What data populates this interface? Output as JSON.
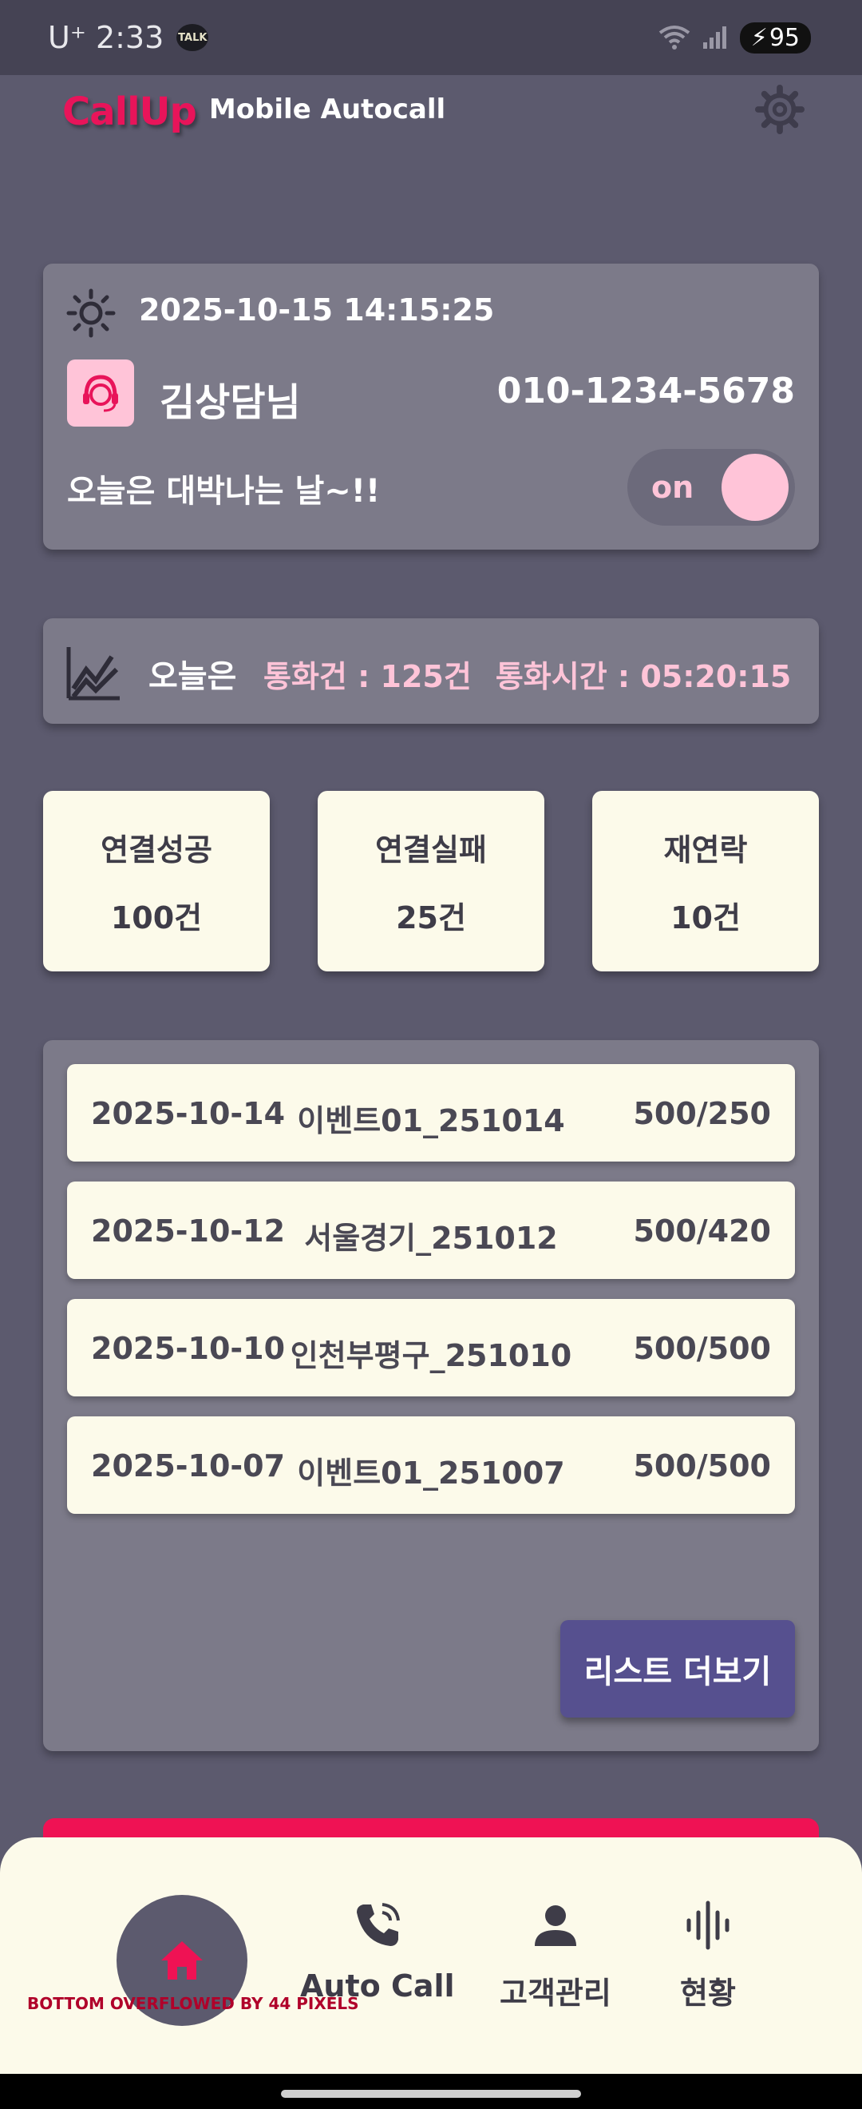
{
  "status_bar": {
    "carrier": "U⁺ 2:33",
    "talk_badge": "TALK",
    "battery": "95",
    "icons": [
      "wifi-icon",
      "signal-icon",
      "battery-icon"
    ]
  },
  "header": {
    "brand": "CallUp",
    "subtitle": "Mobile Autocall",
    "settings_icon": "gear-icon"
  },
  "profile": {
    "datetime": "2025-10-15 14:15:25",
    "name": "김상담님",
    "phone": "010-1234-5678",
    "greeting": "오늘은 대박나는 날~!!",
    "toggle_label": "on",
    "toggle_on": true
  },
  "today": {
    "label": "오늘은",
    "calls": "통화건 : 125건",
    "call_time": "통화시간 : 05:20:15"
  },
  "stats": [
    {
      "title": "연결성공",
      "value": "100건"
    },
    {
      "title": "연결실패",
      "value": "25건"
    },
    {
      "title": "재연락",
      "value": "10건"
    }
  ],
  "list": {
    "rows": [
      {
        "date": "2025-10-14",
        "name": "이벤트01_251014",
        "count": "500/250"
      },
      {
        "date": "2025-10-12",
        "name": "서울경기_251012",
        "count": "500/420"
      },
      {
        "date": "2025-10-10",
        "name": "인천부평구_251010",
        "count": "500/500"
      },
      {
        "date": "2025-10-07",
        "name": "이벤트01_251007",
        "count": "500/500"
      }
    ],
    "more_label": "리스트 더보기"
  },
  "nav": {
    "items": [
      {
        "label": "Auto Call",
        "icon": "phone-call-icon"
      },
      {
        "label": "고객관리",
        "icon": "person-icon"
      },
      {
        "label": "현황",
        "icon": "waveform-icon"
      }
    ],
    "home_icon": "home-icon",
    "overflow_message": "BOTTOM OVERFLOWED BY 44 PIXELS"
  },
  "colors": {
    "background": "#5c5a6e",
    "card": "#7c7a89",
    "accent_pink": "#ffc4d8",
    "brand_red": "#e8145a",
    "button_purple": "#56508f",
    "cream": "#fcfaea"
  }
}
